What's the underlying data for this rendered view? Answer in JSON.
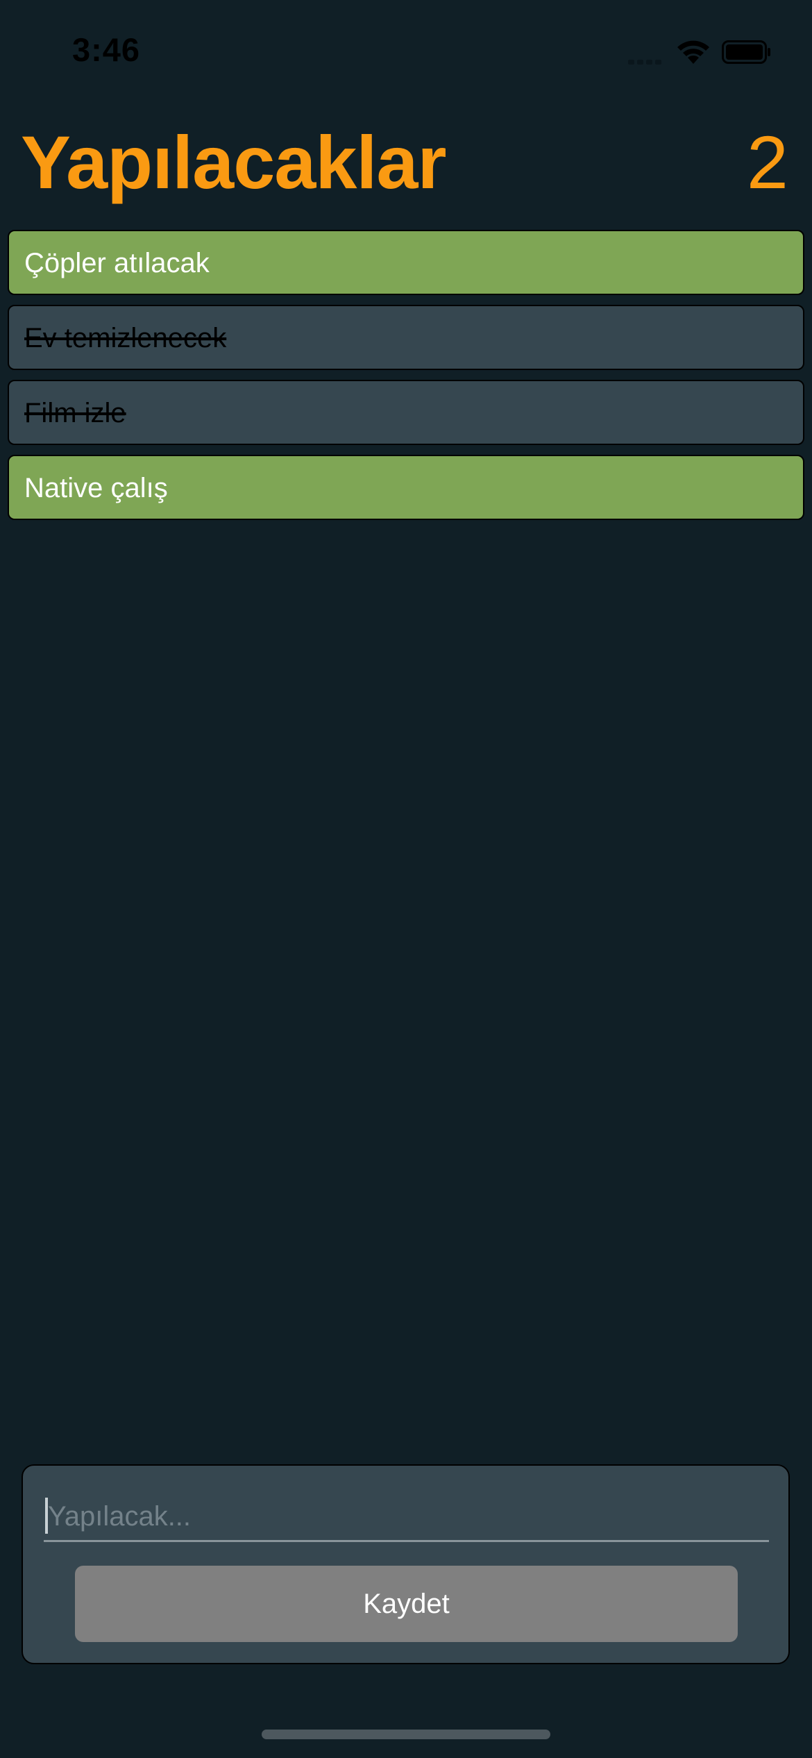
{
  "status_bar": {
    "time": "3:46",
    "icons": [
      "signal-icon",
      "wifi-icon",
      "battery-icon"
    ]
  },
  "header": {
    "title": "Yapılacaklar",
    "count": "2"
  },
  "todos": [
    {
      "label": "Çöpler atılacak",
      "done": false
    },
    {
      "label": "Ev temizlenecek",
      "done": true
    },
    {
      "label": "Film izle",
      "done": true
    },
    {
      "label": "Native çalış",
      "done": false
    }
  ],
  "entry": {
    "placeholder": "Yapılacak...",
    "value": "",
    "save_label": "Kaydet"
  },
  "colors": {
    "background": "#101f26",
    "accent": "#fa9a12",
    "open_item": "#7fa655",
    "done_item": "#364750",
    "button": "#808080"
  }
}
